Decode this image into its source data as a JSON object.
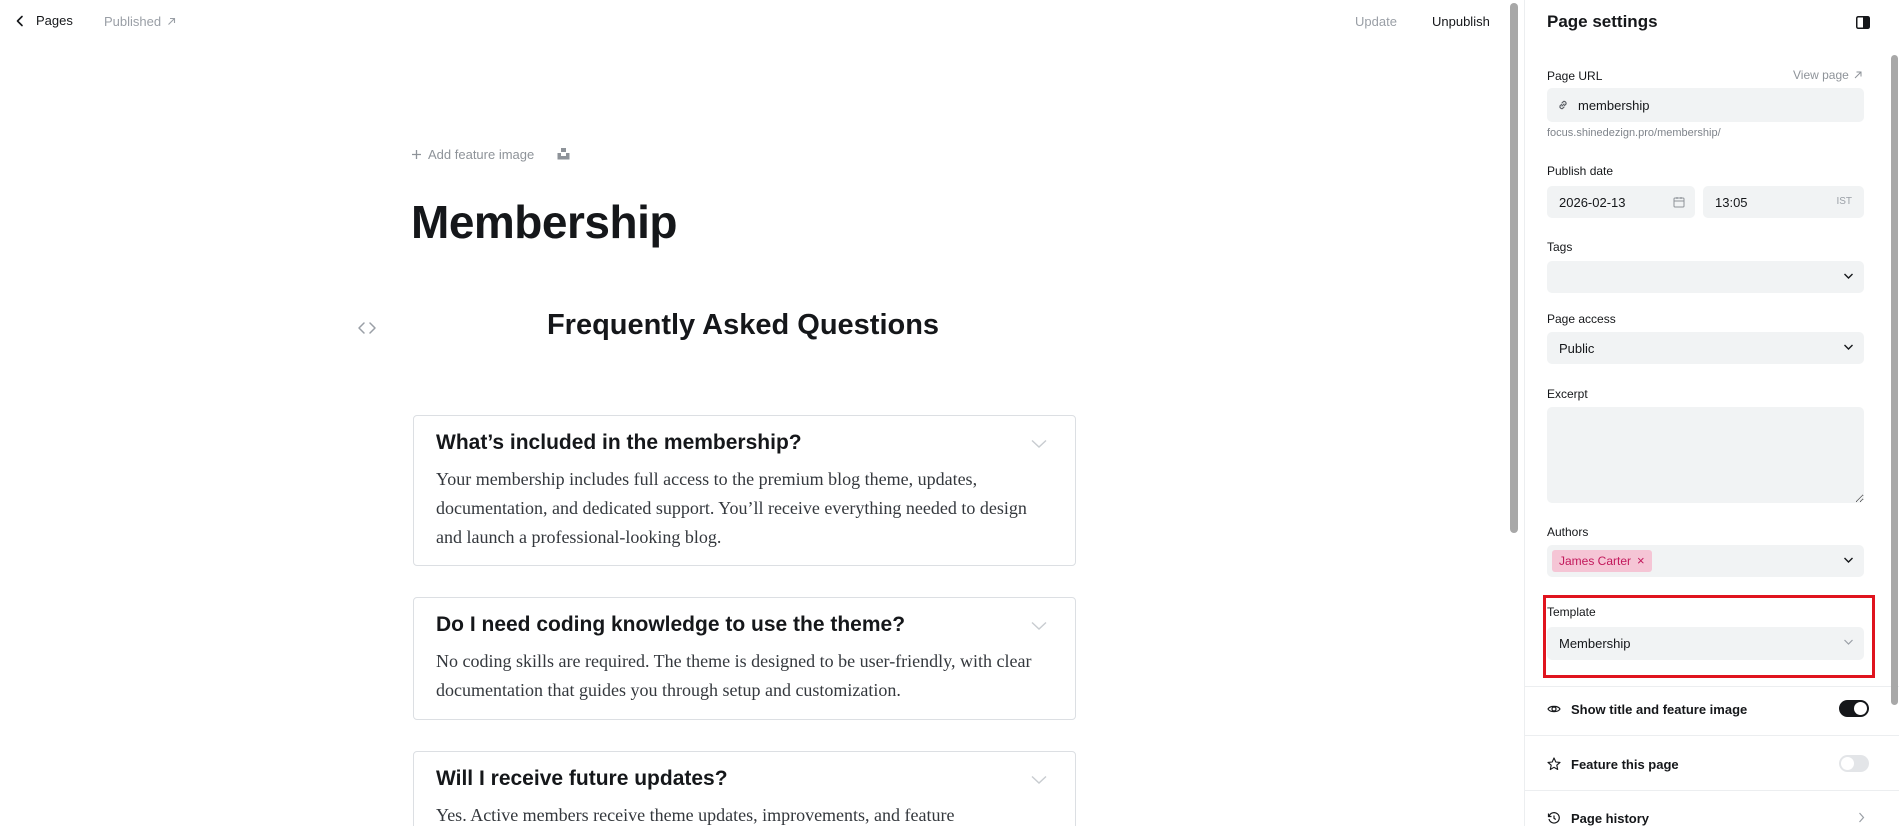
{
  "topbar": {
    "back_label": "Pages",
    "status_label": "Published",
    "update_label": "Update",
    "unpublish_label": "Unpublish"
  },
  "editor": {
    "add_feature_label": "Add feature image",
    "title": "Membership",
    "faq_heading": "Frequently Asked Questions",
    "faqs": [
      {
        "question": "What’s included in the membership?",
        "answer": "Your membership includes full access to the premium blog theme, updates, documentation, and dedicated support. You’ll receive everything needed to design and launch a professional-looking blog."
      },
      {
        "question": "Do I need coding knowledge to use the theme?",
        "answer": "No coding skills are required. The theme is designed to be user-friendly, with clear documentation that guides you through setup and customization."
      },
      {
        "question": "Will I receive future updates?",
        "answer": "Yes. Active members receive theme updates, improvements, and feature"
      }
    ]
  },
  "settings": {
    "title": "Page settings",
    "page_url_label": "Page URL",
    "view_page_label": "View page",
    "page_url_value": "membership",
    "url_hint": "focus.shinedezign.pro/membership/",
    "publish_date_label": "Publish date",
    "publish_date_value": "2026-02-13",
    "publish_time_value": "13:05",
    "timezone": "IST",
    "tags_label": "Tags",
    "tags_value": "",
    "page_access_label": "Page access",
    "page_access_value": "Public",
    "excerpt_label": "Excerpt",
    "excerpt_value": "",
    "authors_label": "Authors",
    "author_name": "James Carter",
    "template_label": "Template",
    "template_value": "Membership",
    "show_title_label": "Show title and feature image",
    "show_title_on": true,
    "feature_label": "Feature this page",
    "feature_on": false,
    "history_label": "Page history"
  },
  "colors": {
    "accent_dark": "#15171a",
    "author_chip_bg": "#f5c5d5",
    "author_chip_text": "#c2185b",
    "highlight_border": "#e0141e",
    "muted_text": "#9a9fa6"
  }
}
